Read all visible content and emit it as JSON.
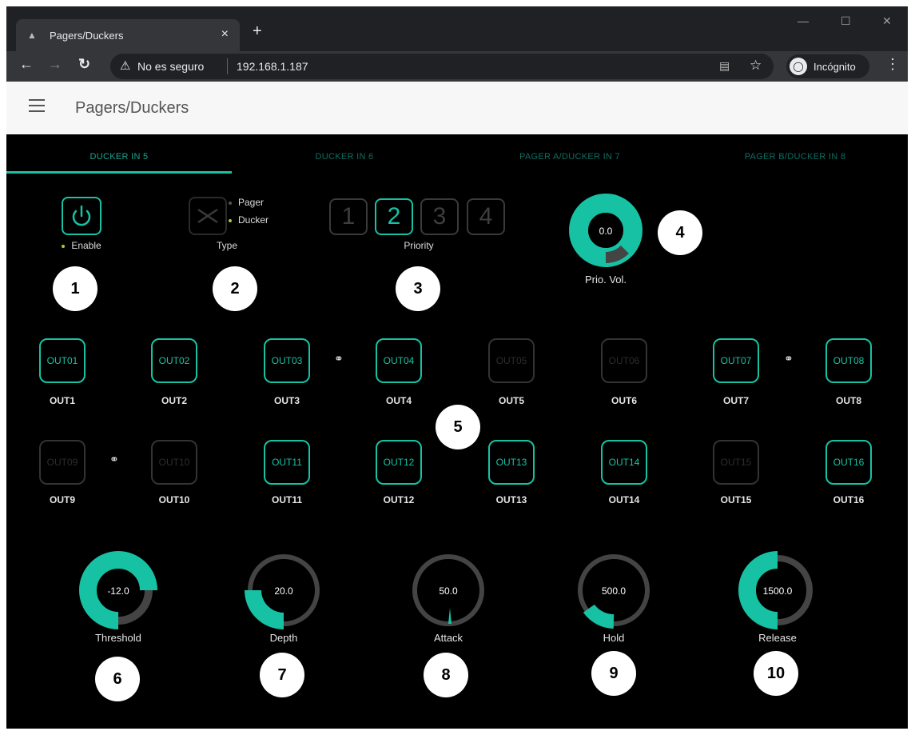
{
  "browser": {
    "tab_title": "Pagers/Duckers",
    "tab_close": "×",
    "new_tab": "+",
    "security_label": "No es seguro",
    "url": "192.168.1.187",
    "incognito_label": "Incógnito"
  },
  "app": {
    "title": "Pagers/Duckers"
  },
  "tabs": [
    {
      "label": "DUCKER IN 5",
      "active": true
    },
    {
      "label": "DUCKER IN 6",
      "active": false
    },
    {
      "label": "PAGER A/DUCKER IN 7",
      "active": false
    },
    {
      "label": "PAGER B/DUCKER IN 8",
      "active": false
    }
  ],
  "controls": {
    "enable_label": "Enable",
    "type_label": "Type",
    "type_options": [
      "Pager",
      "Ducker"
    ],
    "priority_label": "Priority",
    "priority_buttons": [
      "1",
      "2",
      "3",
      "4"
    ],
    "priority_selected": "2",
    "prio_vol_value": "0.0",
    "prio_vol_label": "Prio. Vol."
  },
  "outputs": [
    {
      "button": "OUT01",
      "label": "OUT1",
      "on": true
    },
    {
      "button": "OUT02",
      "label": "OUT2",
      "on": true
    },
    {
      "button": "OUT03",
      "label": "OUT3",
      "on": true
    },
    {
      "button": "OUT04",
      "label": "OUT4",
      "on": true
    },
    {
      "button": "OUT05",
      "label": "OUT5",
      "on": false
    },
    {
      "button": "OUT06",
      "label": "OUT6",
      "on": false
    },
    {
      "button": "OUT07",
      "label": "OUT7",
      "on": true
    },
    {
      "button": "OUT08",
      "label": "OUT8",
      "on": true
    },
    {
      "button": "OUT09",
      "label": "OUT9",
      "on": false
    },
    {
      "button": "OUT10",
      "label": "OUT10",
      "on": false
    },
    {
      "button": "OUT11",
      "label": "OUT11",
      "on": true
    },
    {
      "button": "OUT12",
      "label": "OUT12",
      "on": true
    },
    {
      "button": "OUT13",
      "label": "OUT13",
      "on": true
    },
    {
      "button": "OUT14",
      "label": "OUT14",
      "on": true
    },
    {
      "button": "OUT15",
      "label": "OUT15",
      "on": false
    },
    {
      "button": "OUT16",
      "label": "OUT16",
      "on": true
    }
  ],
  "knobs": [
    {
      "value": "-12.0",
      "label": "Threshold"
    },
    {
      "value": "20.0",
      "label": "Depth"
    },
    {
      "value": "50.0",
      "label": "Attack"
    },
    {
      "value": "500.0",
      "label": "Hold"
    },
    {
      "value": "1500.0",
      "label": "Release"
    }
  ],
  "callouts": [
    "1",
    "2",
    "3",
    "4",
    "5",
    "6",
    "7",
    "8",
    "9",
    "10"
  ],
  "colors": {
    "accent": "#17c2a4",
    "background": "#000000",
    "knob_track": "#444444"
  }
}
